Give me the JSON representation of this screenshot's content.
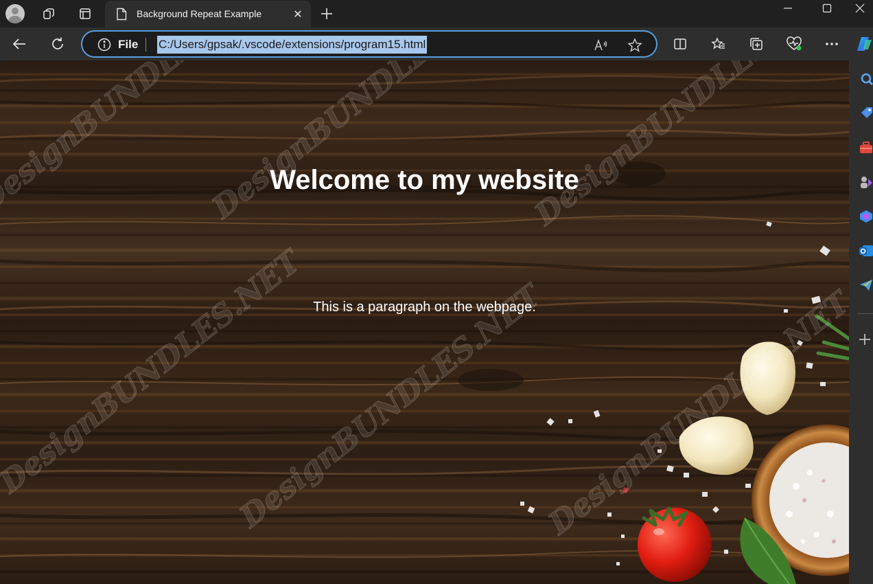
{
  "browser": {
    "tab": {
      "title": "Background Repeat Example",
      "close": "✕"
    },
    "new_tab": "+",
    "address": {
      "scheme_label": "File",
      "url": "C:/Users/gpsak/.vscode/extensions/program15.html"
    },
    "accent_color": "#5a9ee0",
    "selection_color": "#a8c7ec"
  },
  "page": {
    "heading": "Welcome to my website",
    "paragraph": "This is a paragraph on the webpage.",
    "watermark": "DesignBUNDLES.NET"
  },
  "icons": {
    "titlebar": [
      "avatar",
      "workspaces-icon",
      "tab-actions-icon"
    ],
    "toolbar": [
      "back-icon",
      "refresh-icon",
      "info-icon",
      "read-aloud-icon",
      "favorite-star-icon",
      "split-screen-icon",
      "favorites-icon",
      "collections-icon",
      "browser-essentials-icon",
      "more-icon",
      "copilot-icon"
    ],
    "sidebar": [
      "search-icon",
      "shopping-icon",
      "tools-icon",
      "games-icon",
      "copilot-sidebar-icon",
      "outlook-icon",
      "telegram-icon",
      "add-icon"
    ]
  }
}
